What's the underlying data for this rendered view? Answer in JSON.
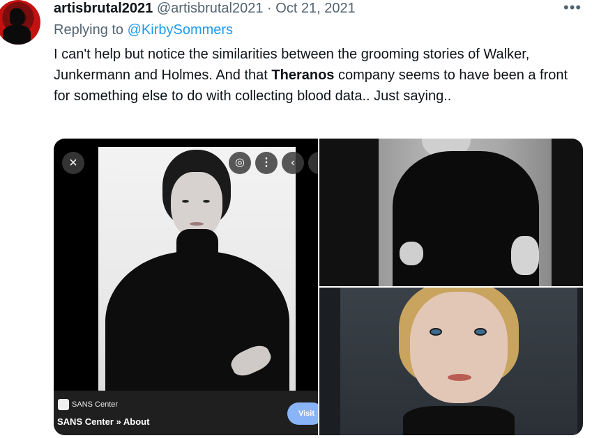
{
  "tweet": {
    "display_name": "artisbrutal2021",
    "handle": "@artisbrutal2021",
    "separator": "·",
    "date": "Oct 21, 2021",
    "more_label": "•••",
    "replying_prefix": "Replying to ",
    "replying_to": "@KirbySommers",
    "text_part1": "I can't help but notice the similarities between the grooming stories of Walker, Junkermann and Holmes.  And that ",
    "text_bold": "Theranos",
    "text_part2": " company seems to have been a front for something else to do with collecting blood data.. Just saying.."
  },
  "media": {
    "left_tile": {
      "close_icon": "×",
      "lens_icon": "◎",
      "menu_icon": "⋮",
      "prev_icon": "‹",
      "source_name": "SANS Center",
      "source_title": "SANS Center » About",
      "visit_label": "Visit"
    }
  },
  "colors": {
    "link": "#1d9bf0",
    "secondary_text": "#536471",
    "primary_text": "#0f1419",
    "visit_button": "#8ab4f8"
  }
}
